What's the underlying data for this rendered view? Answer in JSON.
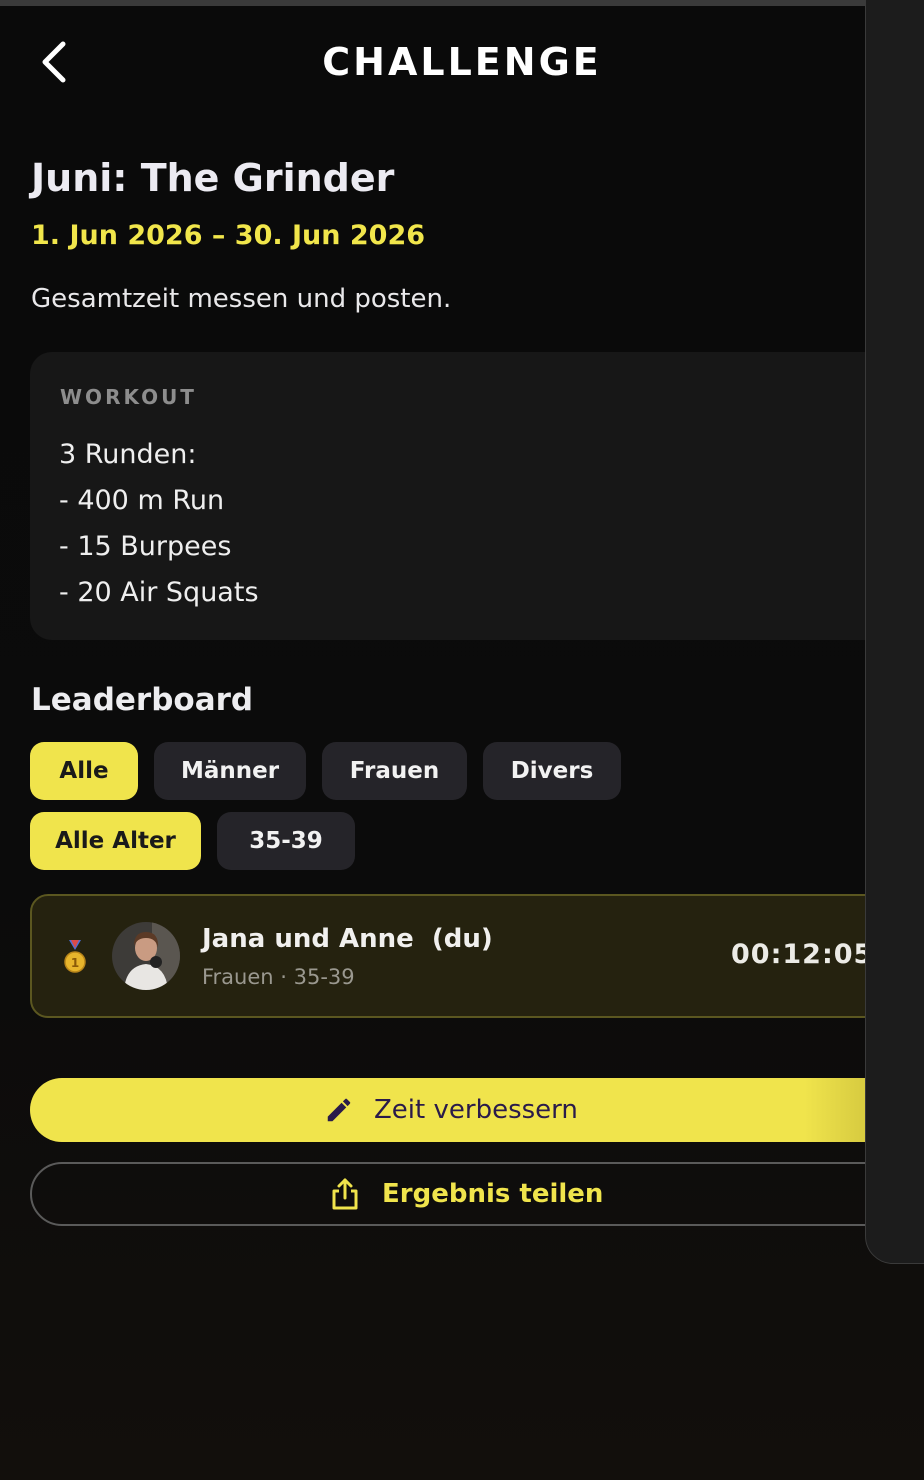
{
  "header": {
    "title": "CHALLENGE",
    "back_icon": "chevron-left-icon"
  },
  "challenge": {
    "title": "Juni: The Grinder",
    "dates": "1. Jun 2026 – 30. Jun 2026",
    "description": "Gesamtzeit messen und posten."
  },
  "workout": {
    "label": "WORKOUT",
    "lines": [
      "3 Runden:",
      "- 400 m Run",
      "- 15 Burpees",
      "- 20 Air Squats"
    ]
  },
  "leaderboard": {
    "heading": "Leaderboard",
    "gender_filters": [
      {
        "label": "Alle",
        "active": true
      },
      {
        "label": "Männer",
        "active": false
      },
      {
        "label": "Frauen",
        "active": false
      },
      {
        "label": "Divers",
        "active": false
      }
    ],
    "age_filters": [
      {
        "label": "Alle Alter",
        "active": true
      },
      {
        "label": "35-39",
        "active": false
      }
    ],
    "entries": [
      {
        "rank_icon": "gold-medal-icon",
        "rank": "1",
        "name": "Jana und Anne  (du)",
        "meta": "Frauen · 35-39",
        "time": "00:12:05"
      }
    ]
  },
  "actions": {
    "improve_label": "Zeit verbessern",
    "improve_icon": "pencil-icon",
    "share_label": "Ergebnis teilen",
    "share_icon": "share-icon"
  },
  "colors": {
    "accent": "#f0e44c",
    "background": "#0b0b0b",
    "card": "#171717"
  }
}
